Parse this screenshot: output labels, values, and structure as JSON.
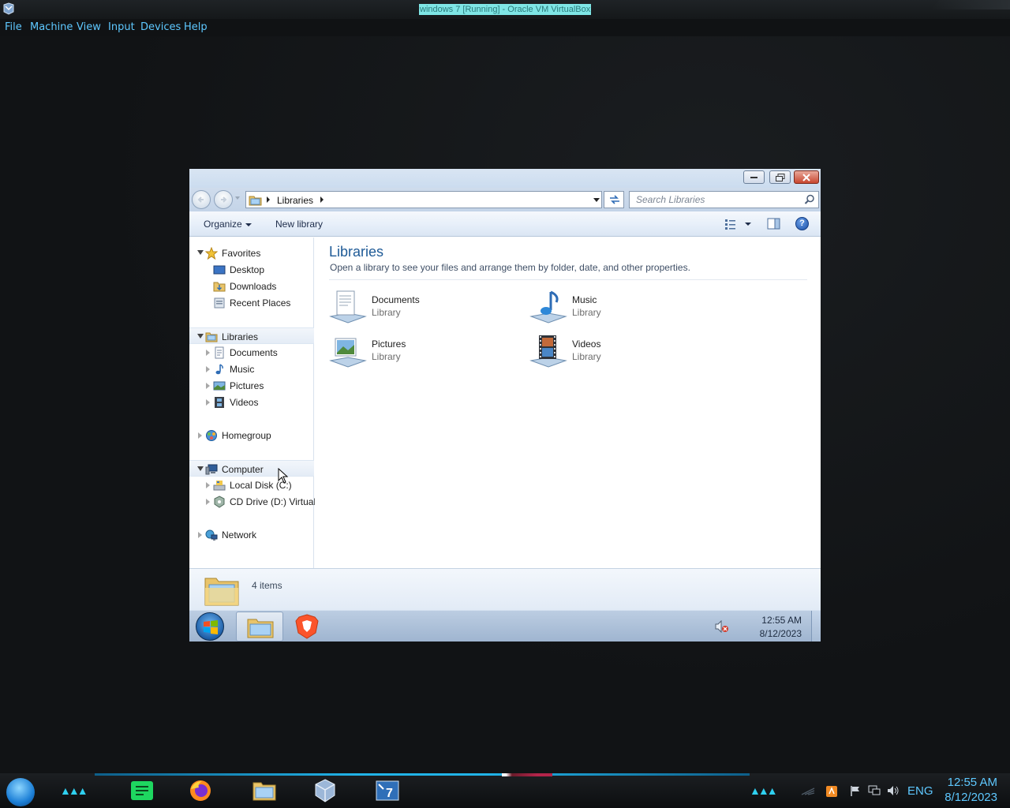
{
  "host": {
    "title": "windows 7 [Running] - Oracle VM VirtualBox",
    "menu": [
      "File",
      "Machine",
      "View",
      "Input",
      "Devices",
      "Help"
    ],
    "taskbar": {
      "language": "ENG",
      "time": "12:55 AM",
      "date": "8/12/2023",
      "apps": [
        "notes-app-icon",
        "firefox-icon",
        "file-manager-icon",
        "virtualbox-icon",
        "windows7-vm-icon"
      ]
    }
  },
  "explorer": {
    "address": {
      "location": "Libraries"
    },
    "search": {
      "placeholder": "Search Libraries"
    },
    "toolbar": {
      "organize": "Organize",
      "new_library": "New library",
      "help": "?"
    },
    "nav_tree": {
      "favorites": "Favorites",
      "desktop": "Desktop",
      "downloads": "Downloads",
      "recent_places": "Recent Places",
      "libraries": "Libraries",
      "documents": "Documents",
      "music": "Music",
      "pictures": "Pictures",
      "videos": "Videos",
      "homegroup": "Homegroup",
      "computer": "Computer",
      "local_disk": "Local Disk (C:)",
      "cd_drive": "CD Drive (D:) Virtual",
      "network": "Network"
    },
    "content": {
      "title": "Libraries",
      "subtitle": "Open a library to see your files and arrange them by folder, date, and other properties.",
      "libraries": [
        {
          "name": "Documents",
          "type": "Library",
          "icon": "documents-library-icon"
        },
        {
          "name": "Music",
          "type": "Library",
          "icon": "music-library-icon"
        },
        {
          "name": "Pictures",
          "type": "Library",
          "icon": "pictures-library-icon"
        },
        {
          "name": "Videos",
          "type": "Library",
          "icon": "videos-library-icon"
        }
      ]
    },
    "details": {
      "items_count": "4 items"
    }
  },
  "guest_taskbar": {
    "time": "12:55 AM",
    "date": "8/12/2023",
    "pinned": [
      "windows-explorer-icon",
      "brave-browser-icon"
    ]
  },
  "colors": {
    "host_accent": "#5ec8ff",
    "content_title": "#1e5a96",
    "close_button": "#c8462f"
  }
}
